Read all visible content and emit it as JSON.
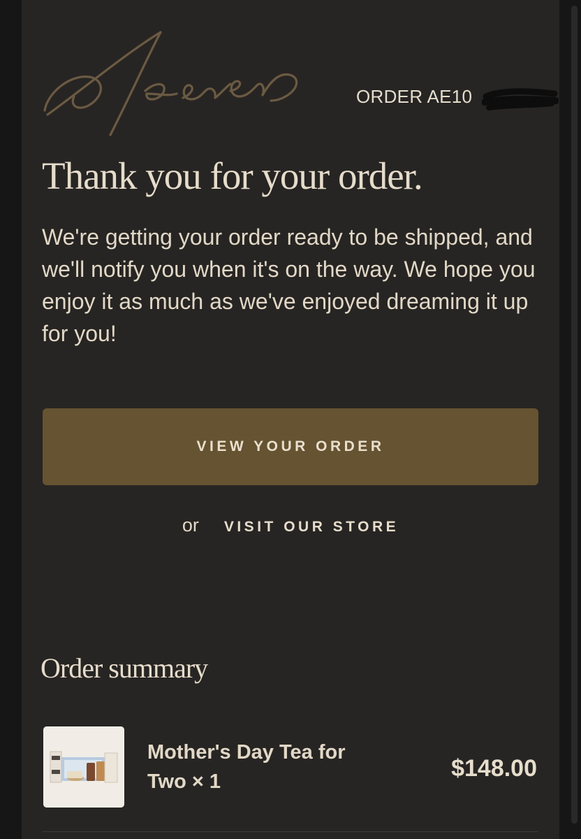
{
  "brand": {
    "logo_text": "As ever",
    "logo_color": "#6b5a43"
  },
  "header": {
    "order_label": "ORDER AE10",
    "order_redacted": true
  },
  "message": {
    "headline": "Thank you for your order.",
    "body": "We're getting your order ready to be shipped, and we'll notify you when it's on the way. We hope you enjoy it as much as we've enjoyed dreaming it up for you!"
  },
  "actions": {
    "primary_label": "VIEW YOUR ORDER",
    "or_text": "or",
    "secondary_label": "VISIT OUR STORE"
  },
  "summary": {
    "title": "Order summary",
    "items": [
      {
        "name": "Mother's Day Tea for Two × 1",
        "price": "$148.00",
        "image": "tea-gift-set-thumbnail"
      }
    ]
  },
  "colors": {
    "background": "#272523",
    "outer_background": "#171617",
    "text": "#e2d8c7",
    "button": "#665331"
  }
}
